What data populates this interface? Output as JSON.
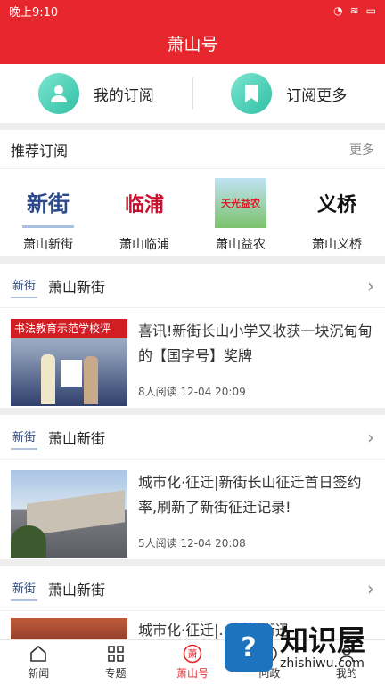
{
  "status": {
    "time": "晚上9:10",
    "icons": [
      "signal-icon",
      "wifi-icon",
      "battery-icon"
    ]
  },
  "header": {
    "title": "萧山号"
  },
  "subscribe": {
    "mine_label": "我的订阅",
    "more_label": "订阅更多"
  },
  "recommend": {
    "title": "推荐订阅",
    "more": "更多",
    "items": [
      {
        "name": "萧山新街",
        "logo_text": "新街"
      },
      {
        "name": "萧山临浦",
        "logo_text": "临浦"
      },
      {
        "name": "萧山益农",
        "logo_text": "天光益农"
      },
      {
        "name": "萧山义桥",
        "logo_text": "义桥"
      }
    ]
  },
  "feed": [
    {
      "source": "萧山新街",
      "source_logo": "新街",
      "title": "喜讯!新街长山小学又收获一块沉甸甸的【国字号】奖牌",
      "meta": "8人阅读   12-04 20:09",
      "thumb_banner": "书法教育示范学校评"
    },
    {
      "source": "萧山新街",
      "source_logo": "新街",
      "title": "城市化·征迁|新街长山征迁首日签约率,刷新了新街征迁记录!",
      "meta": "5人阅读   12-04 20:08",
      "thumb_banner": ""
    },
    {
      "source": "萧山新街",
      "source_logo": "新街",
      "title": "城市化·征迁|...刘新街迅",
      "meta": "",
      "thumb_banner": ""
    }
  ],
  "tabs": [
    {
      "label": "新闻",
      "icon": "home-icon"
    },
    {
      "label": "专题",
      "icon": "grid-icon"
    },
    {
      "label": "萧山号",
      "icon": "xiaoshan-icon",
      "active": true
    },
    {
      "label": "问政",
      "icon": "question-icon"
    },
    {
      "label": "我的",
      "icon": "user-icon"
    }
  ],
  "watermark": {
    "cn": "知识屋",
    "en": "zhishiwu.com",
    "badge": "?"
  },
  "colors": {
    "brand": "#e8262d",
    "teal": "#2fbfa5"
  }
}
